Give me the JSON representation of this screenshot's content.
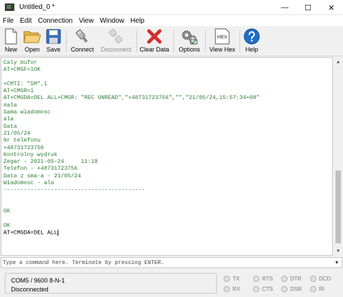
{
  "window": {
    "title": "Untitled_0 *",
    "controls": {
      "minimize": "—",
      "maximize": "☐",
      "close": "✕"
    }
  },
  "menu": {
    "items": [
      "File",
      "Edit",
      "Connection",
      "View",
      "Window",
      "Help"
    ]
  },
  "toolbar": {
    "new_label": "New",
    "open_label": "Open",
    "save_label": "Save",
    "connect_label": "Connect",
    "disconnect_label": "Disconnect",
    "clear_label": "Clear Data",
    "options_label": "Options",
    "viewhex_label": "View Hex",
    "viewhex_icon_text": "HEX",
    "help_label": "Help"
  },
  "terminal": {
    "lines": [
      "Caly bufor",
      "AT+CMGF=1OK",
      "",
      "+CMTI: \"SM\",1",
      "AT+CMGR=1",
      "AT+CMGDA=DEL ALL+CMGR: \"REC UNREAD\",\"+48731723756\",\"\",\"21/05/24,15:57:34+08\"",
      "#ala",
      "Sama wiadomosc",
      "ala",
      "Data",
      "21/05/24",
      "Nr telefonu",
      "+48731723756",
      "Kontrolny wydruk",
      "Zegar - 2021-05-24     11:18",
      "Telefon - +48731723756",
      "Data z sma-a - 21/05/24",
      "Wiadomosc - ala",
      "------------------------------------------",
      "",
      "",
      "OK",
      "",
      "OK",
      "AT+CMGDA=DEL ALL"
    ]
  },
  "command": {
    "placeholder": "Type a command here. Terminate by pressing ENTER."
  },
  "status": {
    "port_settings": "COM5 / 9600 8-N-1",
    "connection_state": "Disconnected",
    "signals": {
      "tx": "TX",
      "rx": "RX",
      "rts": "RTS",
      "cts": "CTS",
      "dtr": "DTR",
      "dsr": "DSR",
      "dcd": "DCD",
      "ri": "RI"
    }
  },
  "colors": {
    "terminal_text": "#2e7d32",
    "clear_icon": "#d32f2f",
    "help_icon": "#1e6fc8"
  }
}
